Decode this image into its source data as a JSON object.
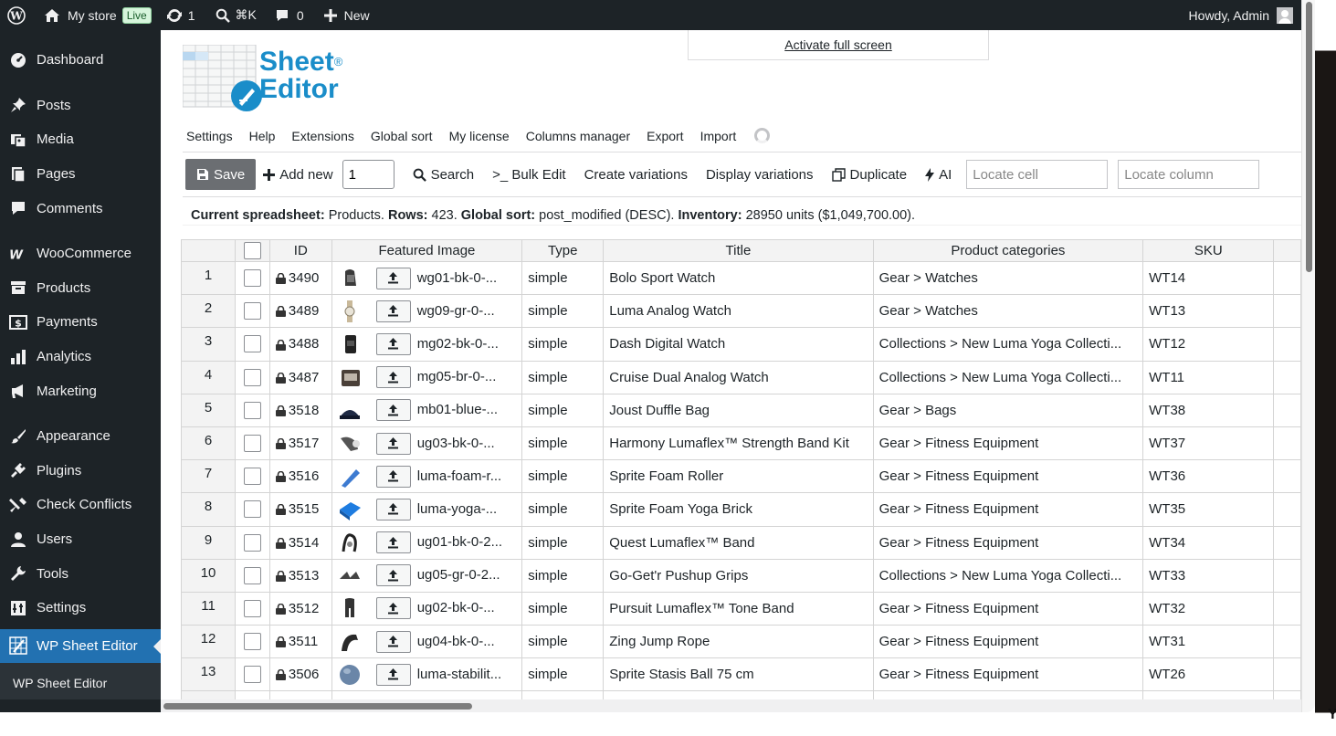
{
  "adminbar": {
    "site_name": "My store",
    "live_badge": "Live",
    "updates_count": "1",
    "search_shortcut": "⌘K",
    "comments_count": "0",
    "new_label": "New",
    "greeting": "Howdy, Admin"
  },
  "sidebar": {
    "items": [
      {
        "label": "Dashboard",
        "icon": "dashboard-icon"
      },
      {
        "label": "Posts",
        "icon": "pin-icon"
      },
      {
        "label": "Media",
        "icon": "media-icon"
      },
      {
        "label": "Pages",
        "icon": "pages-icon"
      },
      {
        "label": "Comments",
        "icon": "comments-icon"
      },
      {
        "label": "WooCommerce",
        "icon": "woocommerce-icon"
      },
      {
        "label": "Products",
        "icon": "archive-icon"
      },
      {
        "label": "Payments",
        "icon": "payments-icon"
      },
      {
        "label": "Analytics",
        "icon": "bar-chart-icon"
      },
      {
        "label": "Marketing",
        "icon": "megaphone-icon"
      },
      {
        "label": "Appearance",
        "icon": "brush-icon"
      },
      {
        "label": "Plugins",
        "icon": "plug-icon"
      },
      {
        "label": "Check Conflicts",
        "icon": "tools-icon"
      },
      {
        "label": "Users",
        "icon": "user-icon"
      },
      {
        "label": "Tools",
        "icon": "wrench-icon"
      },
      {
        "label": "Settings",
        "icon": "settings-icon"
      },
      {
        "label": "WP Sheet Editor",
        "icon": "sheet-icon"
      }
    ],
    "submenu_label": "WP Sheet Editor"
  },
  "logo": {
    "line1": "Sheet",
    "line2": "Editor",
    "reg": "®"
  },
  "fullscreen_link": "Activate full screen",
  "top_menu": [
    "Settings",
    "Help",
    "Extensions",
    "Global sort",
    "My license",
    "Columns manager",
    "Export",
    "Import"
  ],
  "toolbar": {
    "save_label": "Save",
    "add_new_label": "Add new",
    "add_new_qty": "1",
    "search_label": "Search",
    "bulk_edit_label": ">_ Bulk Edit",
    "create_variations_label": "Create variations",
    "display_variations_label": "Display variations",
    "duplicate_label": "Duplicate",
    "ai_label": "AI",
    "locate_cell_placeholder": "Locate cell",
    "locate_column_placeholder": "Locate column"
  },
  "info": {
    "current_label": "Current spreadsheet:",
    "current_value": "Products.",
    "rows_label": "Rows:",
    "rows_value": "423.",
    "sort_label": "Global sort:",
    "sort_value": "post_modified (DESC).",
    "inventory_label": "Inventory:",
    "inventory_value": "28950 units ($1,049,700.00)."
  },
  "table": {
    "headers": [
      "ID",
      "Featured Image",
      "Type",
      "Title",
      "Product categories",
      "SKU"
    ],
    "rows": [
      {
        "num": "1",
        "id": "3490",
        "img": "wg01-bk-0-...",
        "type": "simple",
        "title": "Bolo Sport Watch",
        "cat": "Gear > Watches",
        "sku": "WT14"
      },
      {
        "num": "2",
        "id": "3489",
        "img": "wg09-gr-0-...",
        "type": "simple",
        "title": "Luma Analog Watch",
        "cat": "Gear > Watches",
        "sku": "WT13"
      },
      {
        "num": "3",
        "id": "3488",
        "img": "mg02-bk-0-...",
        "type": "simple",
        "title": "Dash Digital Watch",
        "cat": "Collections > New Luma Yoga Collecti...",
        "sku": "WT12"
      },
      {
        "num": "4",
        "id": "3487",
        "img": "mg05-br-0-...",
        "type": "simple",
        "title": "Cruise Dual Analog Watch",
        "cat": "Collections > New Luma Yoga Collecti...",
        "sku": "WT11"
      },
      {
        "num": "5",
        "id": "3518",
        "img": "mb01-blue-...",
        "type": "simple",
        "title": "Joust Duffle Bag",
        "cat": "Gear > Bags",
        "sku": "WT38"
      },
      {
        "num": "6",
        "id": "3517",
        "img": "ug03-bk-0-...",
        "type": "simple",
        "title": "Harmony Lumaflex™ Strength Band Kit",
        "cat": "Gear > Fitness Equipment",
        "sku": "WT37"
      },
      {
        "num": "7",
        "id": "3516",
        "img": "luma-foam-r...",
        "type": "simple",
        "title": "Sprite Foam Roller",
        "cat": "Gear > Fitness Equipment",
        "sku": "WT36"
      },
      {
        "num": "8",
        "id": "3515",
        "img": "luma-yoga-...",
        "type": "simple",
        "title": "Sprite Foam Yoga Brick",
        "cat": "Gear > Fitness Equipment",
        "sku": "WT35"
      },
      {
        "num": "9",
        "id": "3514",
        "img": "ug01-bk-0-2...",
        "type": "simple",
        "title": "Quest Lumaflex™ Band",
        "cat": "Gear > Fitness Equipment",
        "sku": "WT34"
      },
      {
        "num": "10",
        "id": "3513",
        "img": "ug05-gr-0-2...",
        "type": "simple",
        "title": "Go-Get'r Pushup Grips",
        "cat": "Collections > New Luma Yoga Collecti...",
        "sku": "WT33"
      },
      {
        "num": "11",
        "id": "3512",
        "img": "ug02-bk-0-...",
        "type": "simple",
        "title": "Pursuit Lumaflex™ Tone Band",
        "cat": "Gear > Fitness Equipment",
        "sku": "WT32"
      },
      {
        "num": "12",
        "id": "3511",
        "img": "ug04-bk-0-...",
        "type": "simple",
        "title": "Zing Jump Rope",
        "cat": "Gear > Fitness Equipment",
        "sku": "WT31"
      },
      {
        "num": "13",
        "id": "3506",
        "img": "luma-stabilit...",
        "type": "simple",
        "title": "Sprite Stasis Ball 75 cm",
        "cat": "Gear > Fitness Equipment",
        "sku": "WT26"
      }
    ]
  },
  "colors": {
    "admin_bg": "#1d2327",
    "accent": "#2271b1",
    "save_bg": "#6b6e72",
    "logo_blue": "#1a8dc9"
  }
}
